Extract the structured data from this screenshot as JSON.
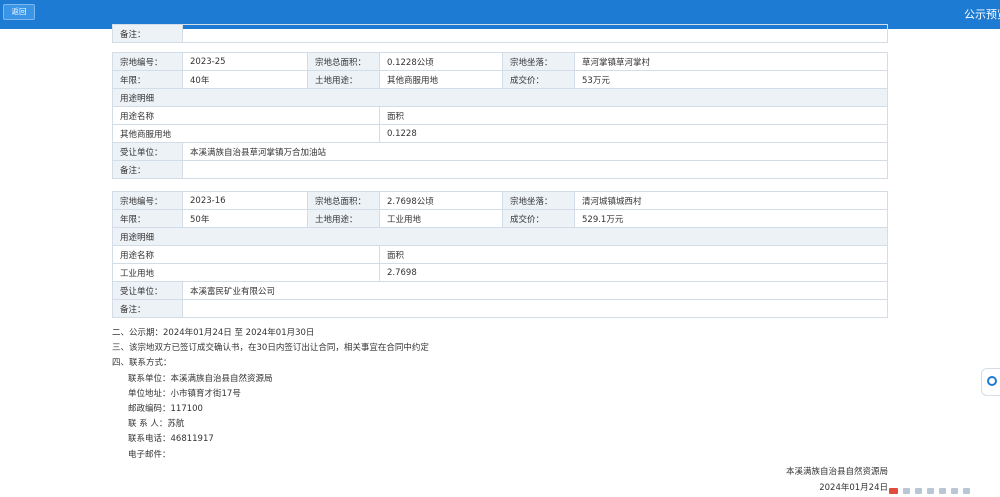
{
  "header": {
    "back_label": "返回",
    "title": "公示预览"
  },
  "top_partial": {
    "remark_label": "备注：",
    "remark_value": ""
  },
  "parcels": [
    {
      "label_code": "宗地编号：",
      "code": "2023-25",
      "label_area": "宗地总面积：",
      "area": "0.1228公顷",
      "label_location": "宗地坐落：",
      "location": "草河掌镇草河掌村",
      "label_term": "年限：",
      "term": "40年",
      "label_use": "土地用途：",
      "use": "其他商服用地",
      "label_price": "成交价：",
      "price": "53万元",
      "usage_section": "用途明细",
      "usage_name_header": "用途名称",
      "usage_area_header": "面积",
      "usage_name": "其他商服用地",
      "usage_area": "0.1228",
      "label_assignee": "受让单位：",
      "assignee": "本溪满族自治县草河掌镇万合加油站",
      "label_remark": "备注：",
      "remark": ""
    },
    {
      "label_code": "宗地编号：",
      "code": "2023-16",
      "label_area": "宗地总面积：",
      "area": "2.7698公顷",
      "label_location": "宗地坐落：",
      "location": "清河城镇城西村",
      "label_term": "年限：",
      "term": "50年",
      "label_use": "土地用途：",
      "use": "工业用地",
      "label_price": "成交价：",
      "price": "529.1万元",
      "usage_section": "用途明细",
      "usage_name_header": "用途名称",
      "usage_area_header": "面积",
      "usage_name": "工业用地",
      "usage_area": "2.7698",
      "label_assignee": "受让单位：",
      "assignee": "本溪富民矿业有限公司",
      "label_remark": "备注：",
      "remark": ""
    }
  ],
  "notes": {
    "period": "二、公示期：2024年01月24日 至 2024年01月30日",
    "confirm": "三、该宗地双方已签订成交确认书，在30日内签订出让合同，相关事宜在合同中约定",
    "contact_heading": "四、联系方式：",
    "contact_unit": "联系单位：本溪满族自治县自然资源局",
    "contact_address": "单位地址：小市镇育才街17号",
    "contact_postcode": "邮政编码：117100",
    "contact_person": "联 系 人：苏航",
    "contact_phone": "联系电话：46811917",
    "contact_email": "电子邮件："
  },
  "footer": {
    "issuer": "本溪满族自治县自然资源局",
    "date": "2024年01月24日"
  },
  "icons": {
    "side_widget": "assistant-icon",
    "tray": [
      "input-method-icon",
      "tray-icons"
    ]
  },
  "colors": {
    "header": "#1e7bd3",
    "label_bg": "#edf2f7",
    "border": "#d3dde8"
  }
}
